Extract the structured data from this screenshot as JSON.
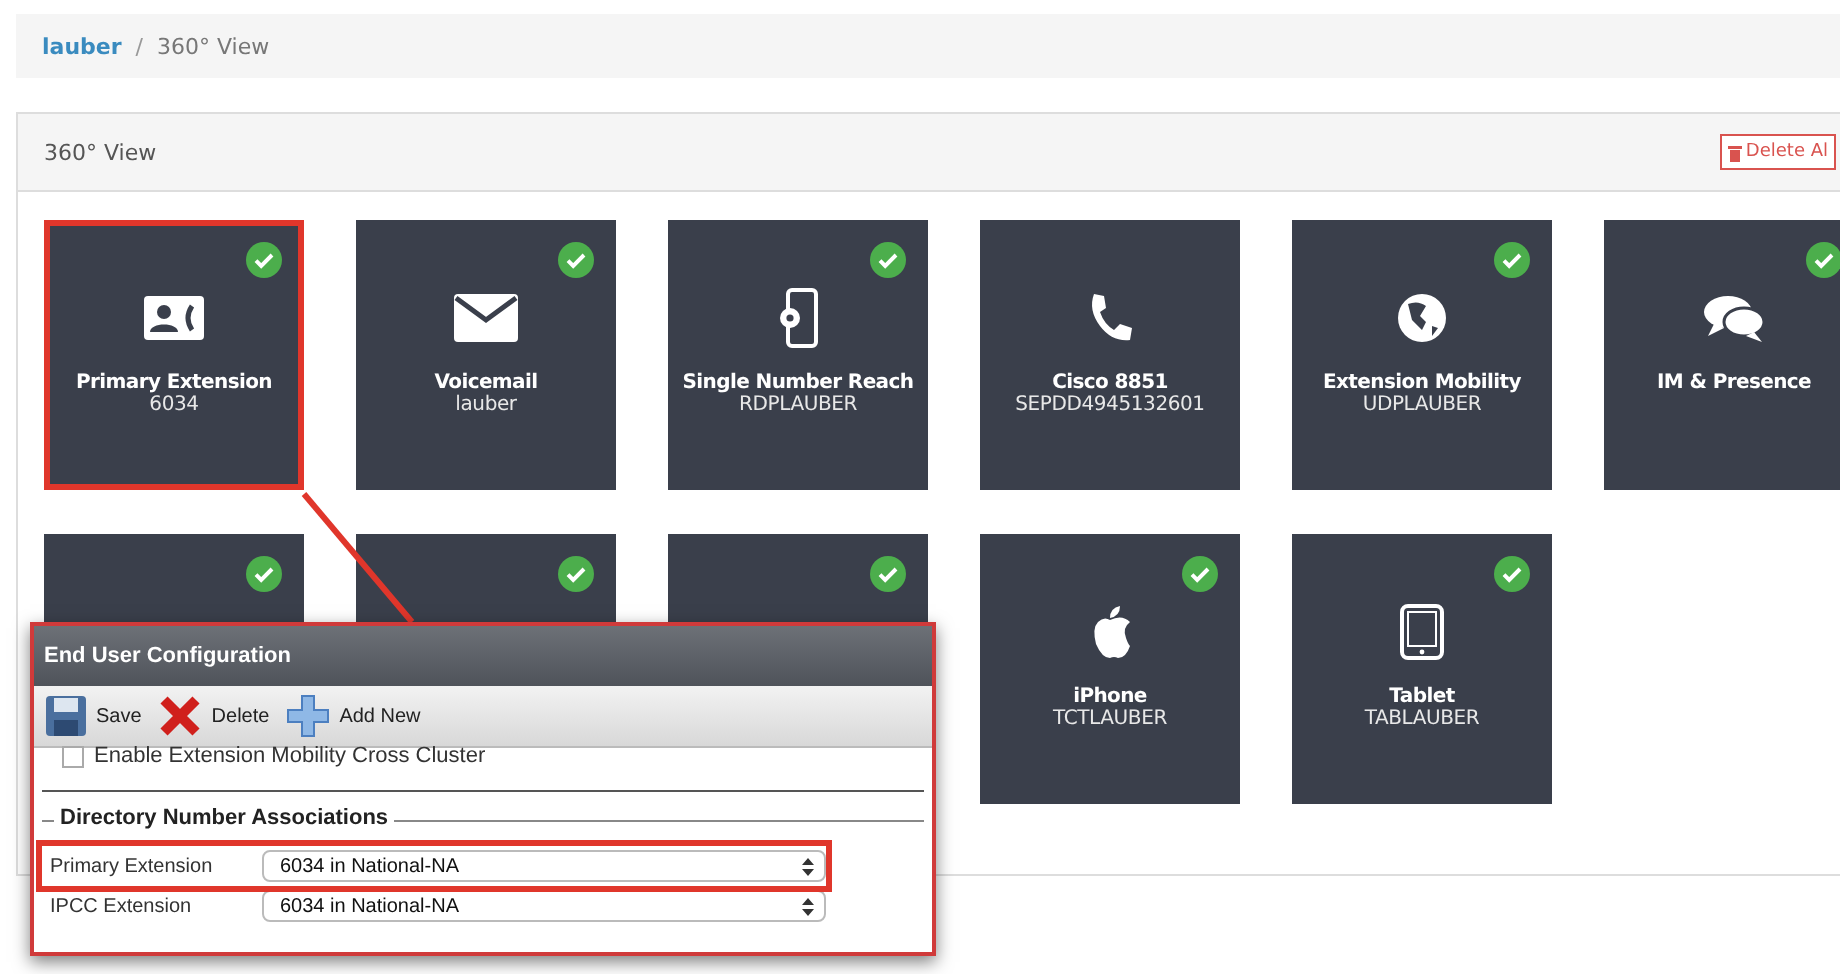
{
  "breadcrumb": {
    "link": "lauber",
    "separator": "/",
    "current": "360° View"
  },
  "panel": {
    "title": "360° View",
    "delete_button": "Delete Al"
  },
  "tiles": [
    {
      "kind": "contact",
      "title": "Primary Extension",
      "subtitle": "6034",
      "checked": true,
      "selected": true
    },
    {
      "kind": "mail",
      "title": "Voicemail",
      "subtitle": "lauber",
      "checked": true,
      "selected": false
    },
    {
      "kind": "mobile",
      "title": "Single Number Reach",
      "subtitle": "RDPLAUBER",
      "checked": true,
      "selected": false
    },
    {
      "kind": "phone",
      "title": "Cisco 8851",
      "subtitle": "SEPDD4945132601",
      "checked": false,
      "selected": false
    },
    {
      "kind": "globe",
      "title": "Extension Mobility",
      "subtitle": "UDPLAUBER",
      "checked": true,
      "selected": false
    },
    {
      "kind": "chat",
      "title": "IM & Presence",
      "checked": true,
      "selected": false
    },
    {
      "kind": "hidden",
      "checked": true,
      "selected": false
    },
    {
      "kind": "hidden",
      "checked": true,
      "selected": false
    },
    {
      "kind": "hidden",
      "checked": true,
      "selected": false
    },
    {
      "kind": "apple",
      "title": "iPhone",
      "subtitle": "TCTLAUBER",
      "checked": true,
      "selected": false
    },
    {
      "kind": "tablet",
      "title": "Tablet",
      "subtitle": "TABLAUBER",
      "checked": true,
      "selected": false
    }
  ],
  "popup": {
    "title": "End User Configuration",
    "toolbar": [
      {
        "kind": "save",
        "label": "Save"
      },
      {
        "kind": "delete",
        "label": "Delete"
      },
      {
        "kind": "add",
        "label": "Add New"
      }
    ],
    "cut_option": {
      "label": "Enable Extension Mobility Cross Cluster",
      "checked": false
    },
    "section": "Directory Number Associations",
    "fields": [
      {
        "label": "Primary Extension",
        "value": "6034 in National-NA",
        "selected": true
      },
      {
        "label": "IPCC Extension",
        "value": "6034 in National-NA",
        "selected": false
      }
    ]
  }
}
